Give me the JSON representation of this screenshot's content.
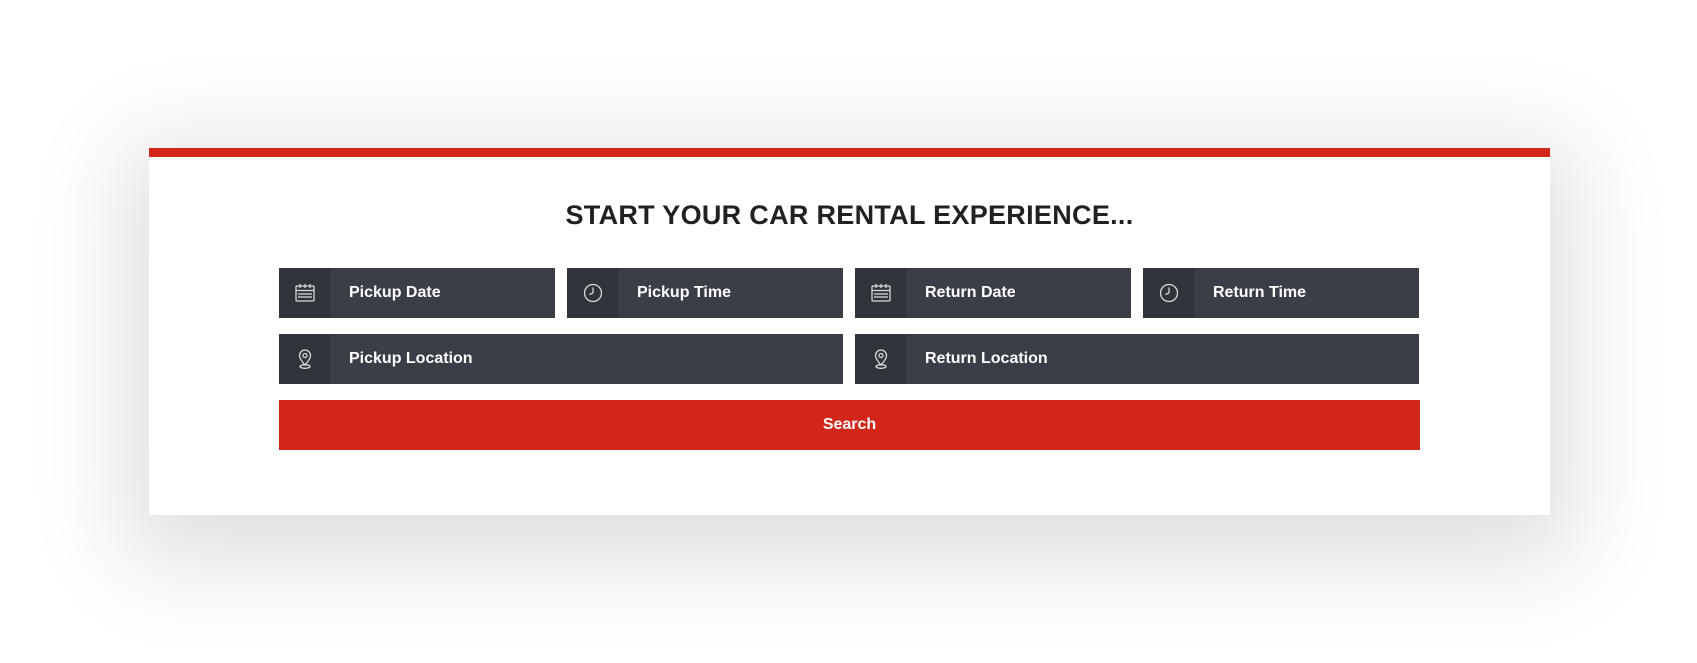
{
  "heading": "START YOUR CAR RENTAL EXPERIENCE...",
  "fields": {
    "pickup_date": {
      "label": "Pickup Date",
      "icon": "calendar-icon"
    },
    "pickup_time": {
      "label": "Pickup Time",
      "icon": "clock-icon"
    },
    "return_date": {
      "label": "Return Date",
      "icon": "calendar-icon"
    },
    "return_time": {
      "label": "Return Time",
      "icon": "clock-icon"
    },
    "pickup_location": {
      "label": "Pickup Location",
      "icon": "location-pin-icon"
    },
    "return_location": {
      "label": "Return Location",
      "icon": "location-pin-icon"
    }
  },
  "search_button": {
    "label": "Search"
  },
  "colors": {
    "accent": "#d3261b",
    "field_background": "#3a3f47",
    "icon_background": "#30343b",
    "heading_text": "#202124",
    "field_text": "#ffffff"
  }
}
